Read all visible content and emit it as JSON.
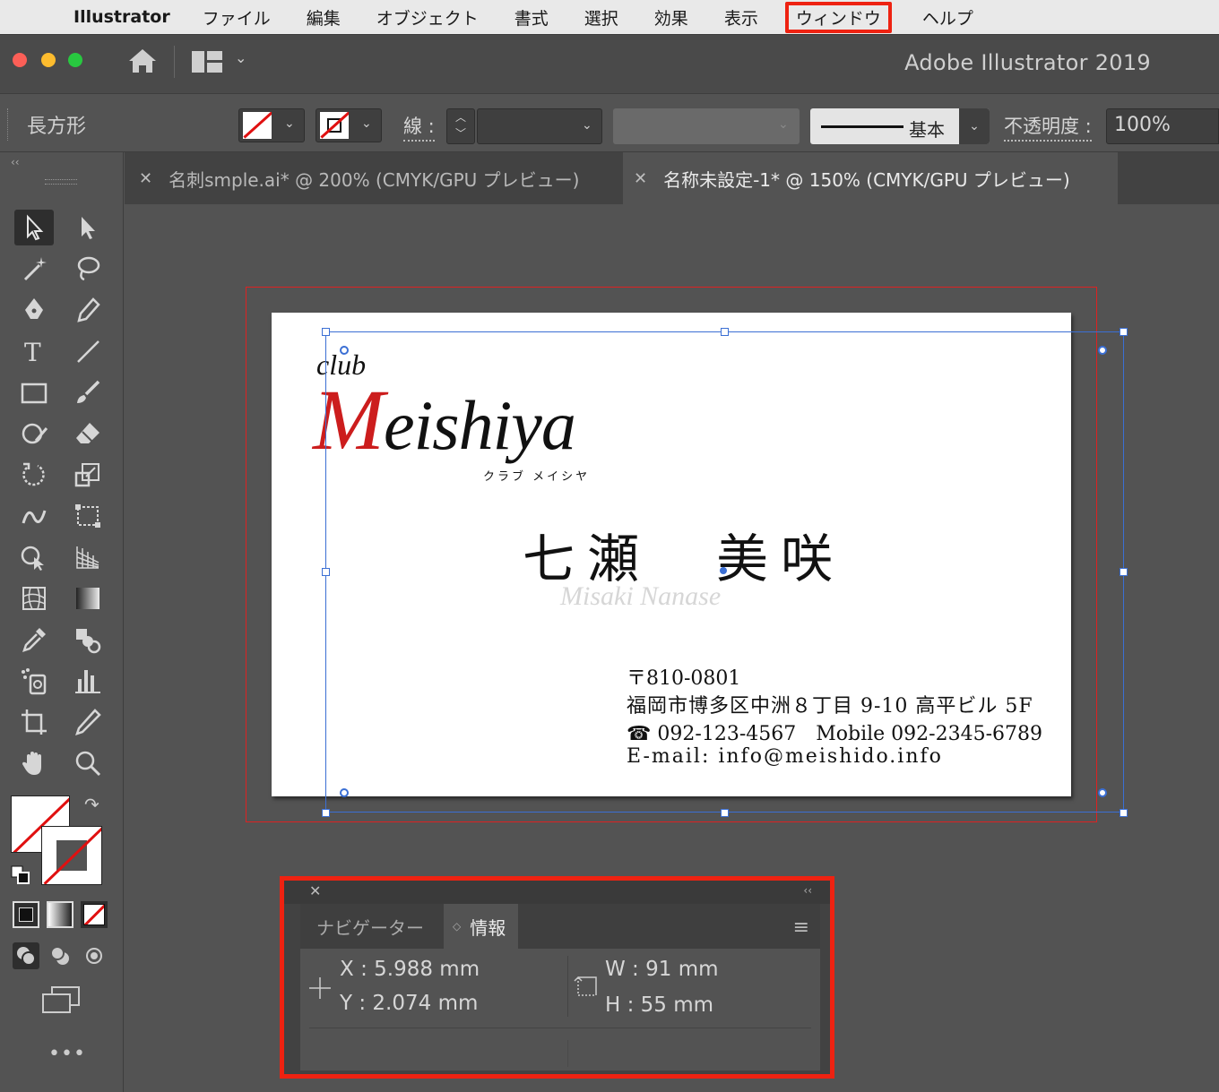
{
  "menubar": {
    "app_name": "Illustrator",
    "items": [
      "ファイル",
      "編集",
      "オブジェクト",
      "書式",
      "選択",
      "効果",
      "表示",
      "ウィンドウ",
      "ヘルプ"
    ],
    "highlighted": "ウィンドウ"
  },
  "appbar": {
    "title": "Adobe Illustrator 2019"
  },
  "control_bar": {
    "object_type": "長方形",
    "stroke_label": "線 :",
    "profile_label": "基本",
    "opacity_label": "不透明度 :",
    "opacity_value": "100%"
  },
  "tabs": [
    {
      "label": "名刺smple.ai* @ 200% (CMYK/GPU プレビュー)",
      "active": false
    },
    {
      "label": "名称未設定-1* @ 150% (CMYK/GPU プレビュー)",
      "active": true
    }
  ],
  "card": {
    "logo_club": "club",
    "logo_initial": "M",
    "logo_rest": "eishiya",
    "logo_kana": "クラブ メイシヤ",
    "name_jp": "七瀬　美咲",
    "name_en": "Misaki Nanase",
    "postal": "〒810-0801",
    "address": "福岡市博多区中洲８丁目 9-10 高平ビル 5F",
    "phone": "☎ 092-123-4567　Mobile 092-2345-6789",
    "email": "E-mail: info@meishido.info"
  },
  "info_panel": {
    "tab_navigator": "ナビゲーター",
    "tab_info": "情報",
    "x": "X :  5.988 mm",
    "y": "Y :  2.074 mm",
    "w": "W :  91 mm",
    "h": "H :  55 mm"
  },
  "colors": {
    "highlight": "#ee2211",
    "selection": "#3b6fd4",
    "logo_red": "#cc1d1d"
  }
}
